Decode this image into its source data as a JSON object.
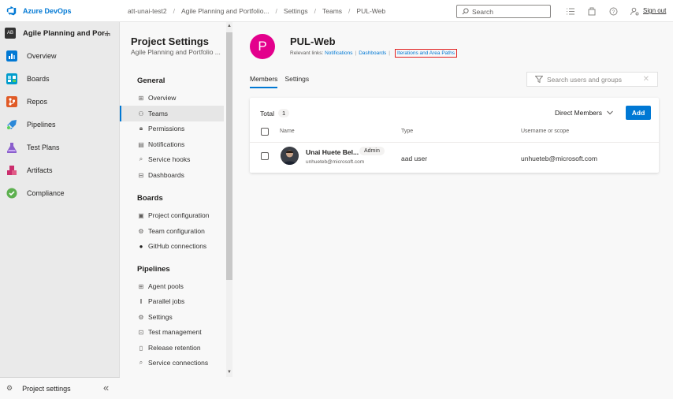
{
  "header": {
    "brand": "Azure DevOps",
    "breadcrumb": [
      "att-unai-test2",
      "Agile Planning and Portfolio...",
      "Settings",
      "Teams",
      "PUL-Web"
    ],
    "search_placeholder": "Search",
    "sign_out": "Sign out"
  },
  "leftnav": {
    "project_initials": "AB",
    "project_name": "Agile Planning and Por...",
    "items": [
      {
        "label": "Overview",
        "icon": "overview-icon",
        "color": "#0078d4"
      },
      {
        "label": "Boards",
        "icon": "boards-icon",
        "color": "#009ccc"
      },
      {
        "label": "Repos",
        "icon": "repos-icon",
        "color": "#e05a26"
      },
      {
        "label": "Pipelines",
        "icon": "pipelines-icon",
        "color": "#2b88d8"
      },
      {
        "label": "Test Plans",
        "icon": "test-plans-icon",
        "color": "#8a5ecc"
      },
      {
        "label": "Artifacts",
        "icon": "artifacts-icon",
        "color": "#cb2e6d"
      },
      {
        "label": "Compliance",
        "icon": "compliance-icon",
        "color": "#5db04f"
      }
    ],
    "project_settings": "Project settings"
  },
  "settings": {
    "title": "Project Settings",
    "subtitle": "Agile Planning and Portfolio ...",
    "groups": [
      {
        "title": "General",
        "items": [
          "Overview",
          "Teams",
          "Permissions",
          "Notifications",
          "Service hooks",
          "Dashboards"
        ]
      },
      {
        "title": "Boards",
        "items": [
          "Project configuration",
          "Team configuration",
          "GitHub connections"
        ]
      },
      {
        "title": "Pipelines",
        "items": [
          "Agent pools",
          "Parallel jobs",
          "Settings",
          "Test management",
          "Release retention",
          "Service connections"
        ]
      }
    ],
    "selected": "Teams"
  },
  "team": {
    "initial": "P",
    "name": "PUL-Web",
    "relevant_label": "Relevant links:",
    "links": [
      "Notifications",
      "Dashboards",
      "Iterations and Area Paths"
    ],
    "tabs": [
      "Members",
      "Settings"
    ],
    "search_placeholder": "Search users and groups"
  },
  "members": {
    "total_label": "Total",
    "total_count": "1",
    "filter": "Direct Members",
    "add": "Add",
    "columns": [
      "Name",
      "Type",
      "Username or scope"
    ],
    "rows": [
      {
        "name": "Unai Huete Bel...",
        "badge": "Admin",
        "email": "unhueteb@microsoft.com",
        "type": "aad user",
        "scope": "unhueteb@microsoft.com"
      }
    ]
  }
}
